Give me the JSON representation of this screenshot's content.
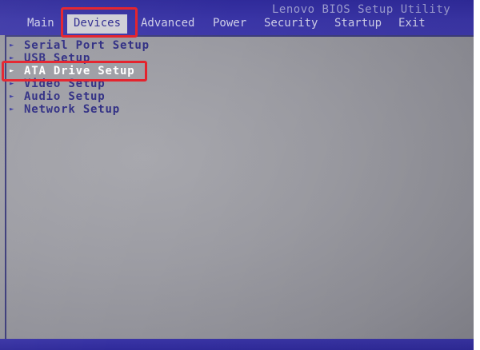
{
  "bios": {
    "title": "Lenovo BIOS Setup Utility",
    "tabs": [
      {
        "label": "Main"
      },
      {
        "label": "Devices",
        "active": true
      },
      {
        "label": "Advanced"
      },
      {
        "label": "Power"
      },
      {
        "label": "Security"
      },
      {
        "label": "Startup"
      },
      {
        "label": "Exit"
      }
    ],
    "menu": [
      {
        "label": "Serial Port Setup"
      },
      {
        "label": "USB Setup"
      },
      {
        "label": "ATA Drive Setup",
        "selected": true
      },
      {
        "label": "Video Setup"
      },
      {
        "label": "Audio Setup"
      },
      {
        "label": "Network Setup"
      }
    ],
    "arrow_glyph": "►",
    "colors": {
      "topbar": "#3a35a6",
      "body": "#9c9ca3",
      "menu_text": "#2f2d83",
      "highlight_box": "#e4202a"
    }
  }
}
